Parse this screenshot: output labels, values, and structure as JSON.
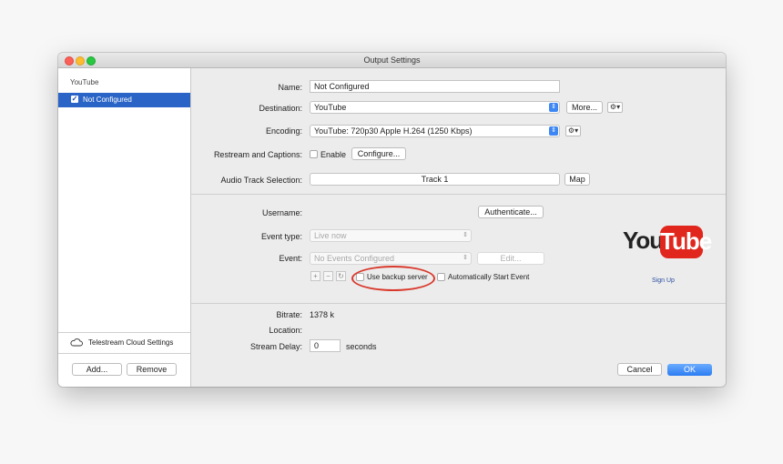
{
  "window": {
    "title": "Output Settings"
  },
  "sidebar": {
    "section": "YouTube",
    "items": [
      {
        "label": "Not Configured",
        "checked": true
      }
    ],
    "cloud_settings": "Telestream Cloud Settings",
    "add_label": "Add...",
    "remove_label": "Remove"
  },
  "general": {
    "name_label": "Name:",
    "name_value": "Not Configured",
    "destination_label": "Destination:",
    "destination_value": "YouTube",
    "more_label": "More...",
    "encoding_label": "Encoding:",
    "encoding_value": "YouTube: 720p30 Apple H.264 (1250 Kbps)",
    "restream_label": "Restream and Captions:",
    "enable_label": "Enable",
    "configure_label": "Configure...",
    "audio_label": "Audio Track Selection:",
    "audio_value": "Track 1",
    "map_label": "Map"
  },
  "account": {
    "username_label": "Username:",
    "authenticate_label": "Authenticate...",
    "event_type_label": "Event type:",
    "event_type_value": "Live now",
    "event_label": "Event:",
    "event_value": "No Events Configured",
    "edit_label": "Edit...",
    "add_symbol": "+",
    "remove_symbol": "−",
    "refresh_symbol": "↻",
    "backup_label": "Use backup server",
    "auto_start_label": "Automatically Start Event",
    "youtube_you": "You",
    "youtube_tube": "Tube",
    "signup_label": "Sign Up"
  },
  "stats": {
    "bitrate_label": "Bitrate:",
    "bitrate_value": "1378 k",
    "location_label": "Location:",
    "delay_label": "Stream Delay:",
    "delay_value": "0",
    "delay_unit": "seconds"
  },
  "footer": {
    "cancel_label": "Cancel",
    "ok_label": "OK"
  },
  "colors": {
    "accent": "#2a64c6",
    "youtube_red": "#e0261d",
    "highlight_oval": "#d9392c"
  }
}
